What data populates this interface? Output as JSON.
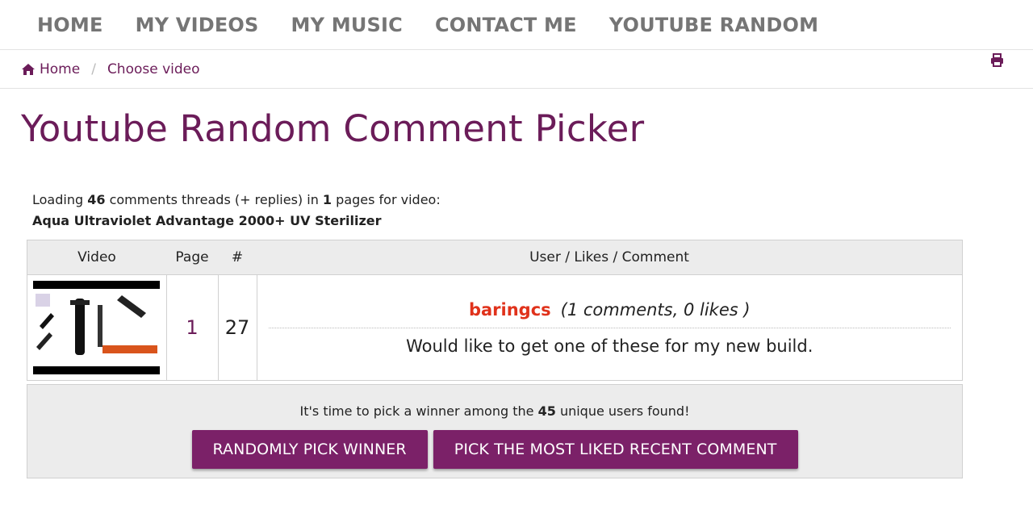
{
  "nav": {
    "items": [
      {
        "label": "HOME"
      },
      {
        "label": "MY VIDEOS"
      },
      {
        "label": "MY MUSIC"
      },
      {
        "label": "CONTACT ME"
      },
      {
        "label": "YOUTUBE RANDOM"
      }
    ]
  },
  "breadcrumb": {
    "home_label": "Home",
    "separator": "/",
    "current_label": "Choose video"
  },
  "page_title": "Youtube Random Comment Picker",
  "loading": {
    "prefix": "Loading",
    "thread_count": "46",
    "middle": "comments threads (+ replies) in",
    "page_count": "1",
    "suffix": "pages for video:",
    "video_title": "Aqua Ultraviolet Advantage 2000+ UV Sterilizer"
  },
  "table": {
    "headers": {
      "video": "Video",
      "page": "Page",
      "index": "#",
      "comment": "User / Likes / Comment"
    },
    "row": {
      "page": "1",
      "index": "27",
      "username": "baringcs",
      "stats": "(1 comments, 0 likes )",
      "comment": "Would like to get one of these for my new build."
    }
  },
  "winner": {
    "prefix": "It's time to pick a winner among the",
    "unique_users": "45",
    "suffix": "unique users found!",
    "random_button": "RANDOMLY PICK WINNER",
    "liked_button": "PICK THE MOST LIKED RECENT COMMENT"
  },
  "colors": {
    "brand": "#6b1c59",
    "button": "#7b2168",
    "username": "#e0321b",
    "nav_text": "#757575"
  }
}
